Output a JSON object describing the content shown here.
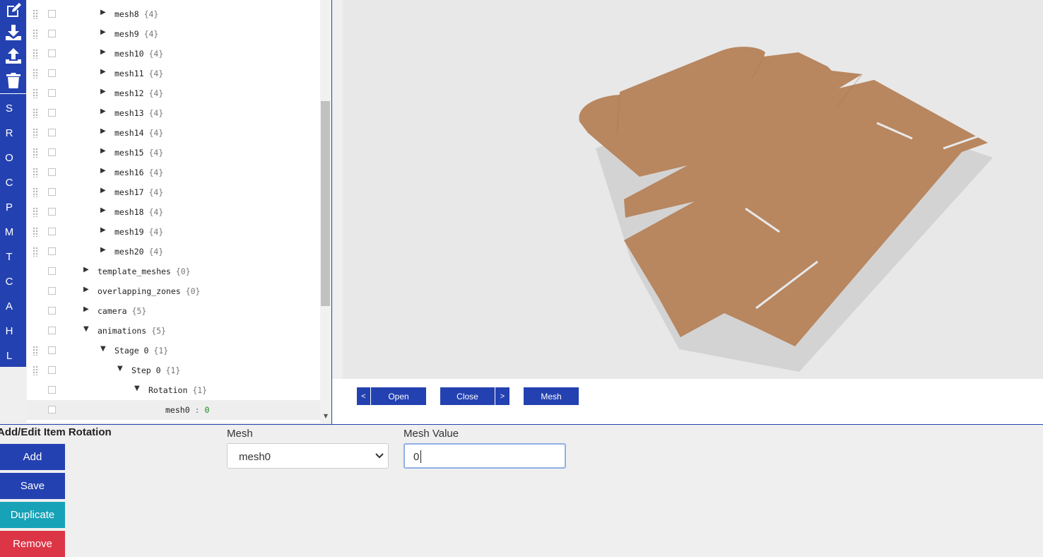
{
  "rail": {
    "icons": [
      "edit-icon",
      "download-icon",
      "upload-icon",
      "trash-icon"
    ],
    "letters": [
      "S",
      "R",
      "O",
      "C",
      "P",
      "M",
      "T",
      "C",
      "A",
      "H",
      "L"
    ]
  },
  "tree": {
    "rows": [
      {
        "label": "mesh8",
        "count": "{4}"
      },
      {
        "label": "mesh9",
        "count": "{4}"
      },
      {
        "label": "mesh10",
        "count": "{4}"
      },
      {
        "label": "mesh11",
        "count": "{4}"
      },
      {
        "label": "mesh12",
        "count": "{4}"
      },
      {
        "label": "mesh13",
        "count": "{4}"
      },
      {
        "label": "mesh14",
        "count": "{4}"
      },
      {
        "label": "mesh15",
        "count": "{4}"
      },
      {
        "label": "mesh16",
        "count": "{4}"
      },
      {
        "label": "mesh17",
        "count": "{4}"
      },
      {
        "label": "mesh18",
        "count": "{4}"
      },
      {
        "label": "mesh19",
        "count": "{4}"
      },
      {
        "label": "mesh20",
        "count": "{4}"
      },
      {
        "label": "template_meshes",
        "count": "{0}"
      },
      {
        "label": "overlapping_zones",
        "count": "{0}"
      },
      {
        "label": "camera",
        "count": "{5}"
      },
      {
        "label": "animations",
        "count": "{5}"
      },
      {
        "label": "Stage 0",
        "count": "{1}"
      },
      {
        "label": "Step 0",
        "count": "{1}"
      },
      {
        "label": "Rotation",
        "count": "{1}"
      },
      {
        "label": "mesh0",
        "colon": ":",
        "value": "0"
      }
    ]
  },
  "controls": {
    "prev": "<",
    "open": "Open",
    "close": "Close",
    "next": ">",
    "mesh": "Mesh"
  },
  "form": {
    "title": "Add/Edit Item Rotation",
    "add": "Add",
    "save": "Save",
    "duplicate": "Duplicate",
    "remove": "Remove",
    "mesh_label": "Mesh",
    "mesh_selected": "mesh0",
    "value_label": "Mesh Value",
    "value": "0"
  },
  "colors": {
    "primary": "#2341b0",
    "duplicate": "#17a2b8",
    "remove": "#dc3545",
    "cardboard": "#b8865f"
  }
}
